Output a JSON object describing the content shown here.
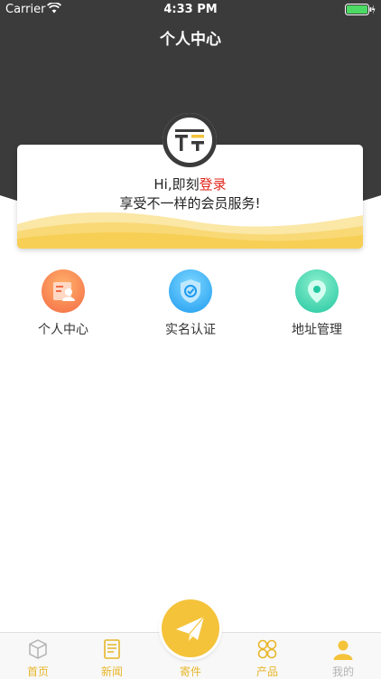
{
  "status_bar": {
    "carrier": "Carrier",
    "time": "4:33 PM"
  },
  "nav": {
    "title": "个人中心"
  },
  "card": {
    "greeting_prefix": "Hi,即刻",
    "login_link": "登录",
    "subtitle": "享受不一样的会员服务!"
  },
  "shortcuts": [
    {
      "label": "个人中心",
      "icon": "profile-card-icon",
      "color": "#f46b45"
    },
    {
      "label": "实名认证",
      "icon": "shield-check-icon",
      "color": "#1e9bf0"
    },
    {
      "label": "地址管理",
      "icon": "location-pin-icon",
      "color": "#22c7a0"
    }
  ],
  "tabs": [
    {
      "label": "首页",
      "icon": "box-icon"
    },
    {
      "label": "新闻",
      "icon": "news-icon"
    },
    {
      "label": "寄件",
      "icon": "paper-plane-icon"
    },
    {
      "label": "产品",
      "icon": "grid-icon"
    },
    {
      "label": "我的",
      "icon": "user-icon"
    }
  ],
  "colors": {
    "accent": "#f4c33a",
    "header": "#3b3b3b",
    "login": "#e0261b"
  }
}
